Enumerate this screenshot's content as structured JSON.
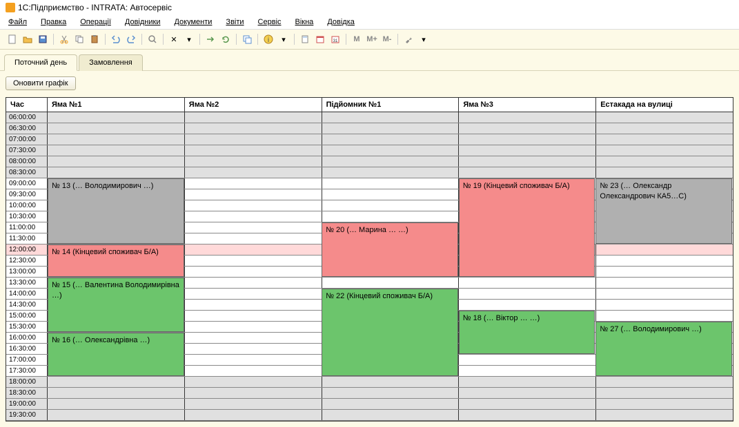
{
  "window": {
    "title": "1С:Підприємство - INTRATA: Автосервіс"
  },
  "menu": [
    "Файл",
    "Правка",
    "Операції",
    "Довідники",
    "Документи",
    "Звіти",
    "Сервіс",
    "Вікна",
    "Довідка"
  ],
  "toolbar": {
    "m": "M",
    "mplus": "M+",
    "mminus": "M-"
  },
  "tabs": [
    {
      "label": "Поточний день",
      "active": true
    },
    {
      "label": "Замовлення",
      "active": false
    }
  ],
  "buttons": {
    "refresh": "Оновити графік"
  },
  "schedule": {
    "time_header": "Час",
    "bays": [
      "Яма №1",
      "Яма №2",
      "Підйомник №1",
      "Яма №3",
      "Естакада на вулиці"
    ],
    "rows": [
      {
        "t": "06:00:00",
        "cls": "faded"
      },
      {
        "t": "06:30:00",
        "cls": "faded"
      },
      {
        "t": "07:00:00",
        "cls": "faded"
      },
      {
        "t": "07:30:00",
        "cls": "faded"
      },
      {
        "t": "08:00:00",
        "cls": "faded"
      },
      {
        "t": "08:30:00",
        "cls": "faded"
      },
      {
        "t": "09:00:00",
        "cls": ""
      },
      {
        "t": "09:30:00",
        "cls": ""
      },
      {
        "t": "10:00:00",
        "cls": ""
      },
      {
        "t": "10:30:00",
        "cls": ""
      },
      {
        "t": "11:00:00",
        "cls": ""
      },
      {
        "t": "11:30:00",
        "cls": ""
      },
      {
        "t": "12:00:00",
        "cls": "noon"
      },
      {
        "t": "12:30:00",
        "cls": ""
      },
      {
        "t": "13:00:00",
        "cls": ""
      },
      {
        "t": "13:30:00",
        "cls": ""
      },
      {
        "t": "14:00:00",
        "cls": ""
      },
      {
        "t": "14:30:00",
        "cls": ""
      },
      {
        "t": "15:00:00",
        "cls": ""
      },
      {
        "t": "15:30:00",
        "cls": ""
      },
      {
        "t": "16:00:00",
        "cls": ""
      },
      {
        "t": "16:30:00",
        "cls": ""
      },
      {
        "t": "17:00:00",
        "cls": ""
      },
      {
        "t": "17:30:00",
        "cls": ""
      },
      {
        "t": "18:00:00",
        "cls": "faded"
      },
      {
        "t": "18:30:00",
        "cls": "faded"
      },
      {
        "t": "19:00:00",
        "cls": "faded"
      },
      {
        "t": "19:30:00",
        "cls": "faded"
      }
    ],
    "appointments": [
      {
        "bay": 0,
        "start": 6,
        "span": 6,
        "color": "gray",
        "text": "№ 13 (… Володимирович …)"
      },
      {
        "bay": 0,
        "start": 12,
        "span": 3,
        "color": "red",
        "text": "№ 14 (Кінцевий споживач Б/А)"
      },
      {
        "bay": 0,
        "start": 15,
        "span": 5,
        "color": "green",
        "text": "№ 15 (… Валентина Володимирівна …)"
      },
      {
        "bay": 0,
        "start": 20,
        "span": 4,
        "color": "green",
        "text": "№ 16 (… Олександрівна …)"
      },
      {
        "bay": 2,
        "start": 10,
        "span": 5,
        "color": "red",
        "text": "№ 20 (… Марина … …)"
      },
      {
        "bay": 2,
        "start": 16,
        "span": 8,
        "color": "green",
        "text": "№ 22 (Кінцевий споживач Б/А)"
      },
      {
        "bay": 3,
        "start": 6,
        "span": 9,
        "color": "red",
        "text": "№ 19 (Кінцевий споживач Б/А)"
      },
      {
        "bay": 3,
        "start": 18,
        "span": 4,
        "color": "green",
        "text": "№ 18 (… Віктор … …)"
      },
      {
        "bay": 4,
        "start": 6,
        "span": 6,
        "color": "gray",
        "text": "№ 23 (… Олександр Олександрович КА5…С)"
      },
      {
        "bay": 4,
        "start": 19,
        "span": 5,
        "color": "green",
        "text": "№ 27 (… Володимирович …)"
      }
    ]
  }
}
